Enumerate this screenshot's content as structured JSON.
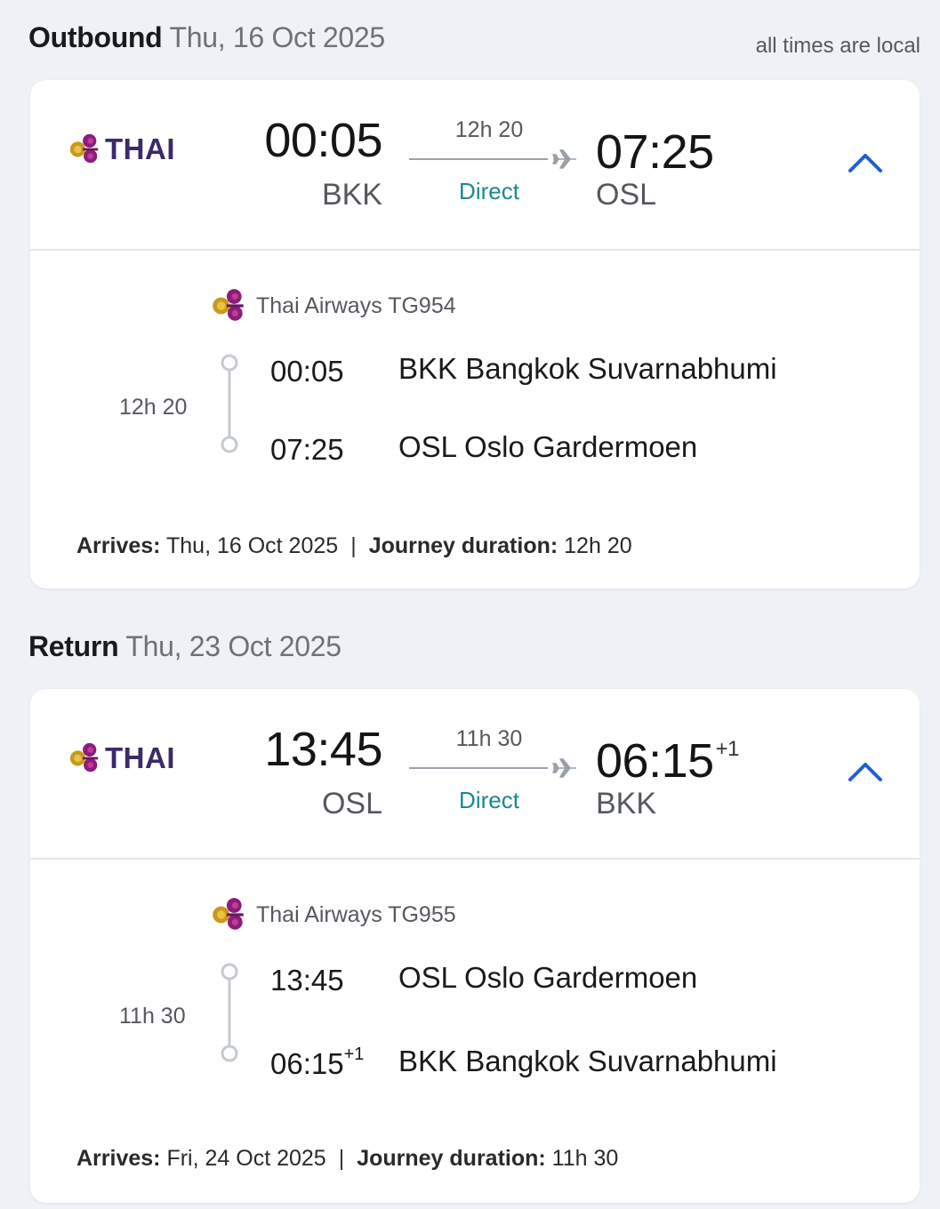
{
  "legs": [
    {
      "kind": "Outbound",
      "date": "Thu, 16 Oct 2025",
      "note": "all times are local",
      "brand": "THAI",
      "dep_time": "00:05",
      "dep_code": "BKK",
      "arr_time": "07:25",
      "arr_day_offset": "",
      "arr_code": "OSL",
      "duration": "12h 20",
      "stops": "Direct",
      "airline_flight": "Thai Airways TG954",
      "segment_duration": "12h 20",
      "seg_dep_time": "00:05",
      "seg_dep_offset": "",
      "seg_dep_place": "BKK Bangkok Suvarnabhumi",
      "seg_arr_time": "07:25",
      "seg_arr_offset": "",
      "seg_arr_place": "OSL Oslo Gardermoen",
      "arrives_label": "Arrives:",
      "arrives_value": "Thu, 16 Oct 2025",
      "journey_label": "Journey duration:",
      "journey_value": "12h 20"
    },
    {
      "kind": "Return",
      "date": "Thu, 23 Oct 2025",
      "note": "",
      "brand": "THAI",
      "dep_time": "13:45",
      "dep_code": "OSL",
      "arr_time": "06:15",
      "arr_day_offset": "+1",
      "arr_code": "BKK",
      "duration": "11h 30",
      "stops": "Direct",
      "airline_flight": "Thai Airways TG955",
      "segment_duration": "11h 30",
      "seg_dep_time": "13:45",
      "seg_dep_offset": "",
      "seg_dep_place": "OSL Oslo Gardermoen",
      "seg_arr_time": "06:15",
      "seg_arr_offset": "+1",
      "seg_arr_place": "BKK Bangkok Suvarnabhumi",
      "arrives_label": "Arrives:",
      "arrives_value": "Fri, 24 Oct 2025",
      "journey_label": "Journey duration:",
      "journey_value": "11h 30"
    }
  ],
  "colors": {
    "brand": "#3c2a6b",
    "accent": "#1f5fd6",
    "direct": "#1c8a8a",
    "page_bg": "#eef1f6"
  },
  "icons": {
    "logo": "thai-orchid-logo-icon",
    "plane": "plane-icon",
    "collapse": "chevron-up-icon",
    "timeline": "timeline-icon"
  }
}
